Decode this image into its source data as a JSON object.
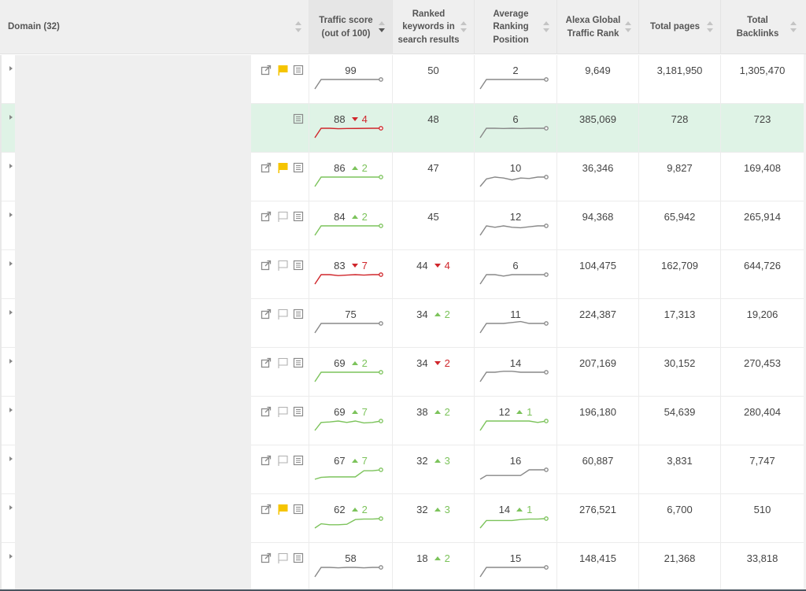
{
  "colors": {
    "up": "#7cc35b",
    "down": "#d0262b",
    "neutral": "#888888",
    "flag_active": "#f5c400",
    "highlight_row": "#dff3e6"
  },
  "header": {
    "columns": [
      {
        "key": "domain",
        "label": "Domain (32)"
      },
      {
        "key": "traffic",
        "label": "Traffic score\n(out of 100)",
        "sorted": "desc"
      },
      {
        "key": "keywords",
        "label": "Ranked\nkeywords in\nsearch results"
      },
      {
        "key": "avgpos",
        "label": "Average\nRanking\nPosition"
      },
      {
        "key": "alexa",
        "label": "Alexa Global\nTraffic Rank"
      },
      {
        "key": "pages",
        "label": "Total pages"
      },
      {
        "key": "backlinks",
        "label": "Total\nBacklinks"
      }
    ]
  },
  "rows": [
    {
      "highlight": false,
      "icons": {
        "external": true,
        "flag": "active",
        "details": true
      },
      "traffic": {
        "value": "99",
        "change": null,
        "dir": "neutral",
        "trend": [
          0,
          1,
          1,
          1,
          1,
          1,
          1,
          1,
          1
        ]
      },
      "keywords": {
        "value": "50",
        "change": null,
        "dir": null
      },
      "avgpos": {
        "value": "2",
        "change": null,
        "dir": "neutral",
        "trend": [
          0,
          1,
          1,
          1,
          1,
          1,
          1,
          1,
          1
        ]
      },
      "alexa": "9,649",
      "pages": "3,181,950",
      "backlinks": "1,305,470"
    },
    {
      "highlight": true,
      "icons": {
        "external": false,
        "flag": "none",
        "details": true
      },
      "traffic": {
        "value": "88",
        "change": "4",
        "dir": "down",
        "trend": [
          0,
          1,
          1,
          0.95,
          0.97,
          0.98,
          0.99,
          1,
          1
        ]
      },
      "keywords": {
        "value": "48",
        "change": null,
        "dir": null
      },
      "avgpos": {
        "value": "6",
        "change": null,
        "dir": "neutral",
        "trend": [
          0,
          1,
          1,
          0.97,
          1,
          0.97,
          1,
          1,
          1
        ]
      },
      "alexa": "385,069",
      "pages": "728",
      "backlinks": "723"
    },
    {
      "highlight": false,
      "icons": {
        "external": true,
        "flag": "active",
        "details": true
      },
      "traffic": {
        "value": "86",
        "change": "2",
        "dir": "up",
        "trend": [
          0,
          1,
          1,
          1,
          1,
          1,
          1,
          1,
          1
        ]
      },
      "keywords": {
        "value": "47",
        "change": null,
        "dir": null
      },
      "avgpos": {
        "value": "10",
        "change": null,
        "dir": "neutral",
        "trend": [
          0,
          0.8,
          1,
          0.9,
          0.7,
          0.9,
          0.85,
          1,
          1
        ]
      },
      "alexa": "36,346",
      "pages": "9,827",
      "backlinks": "169,408"
    },
    {
      "highlight": false,
      "icons": {
        "external": true,
        "flag": "empty",
        "details": true
      },
      "traffic": {
        "value": "84",
        "change": "2",
        "dir": "up",
        "trend": [
          0,
          1,
          1,
          1,
          1,
          1,
          1,
          1,
          1
        ]
      },
      "keywords": {
        "value": "45",
        "change": null,
        "dir": null
      },
      "avgpos": {
        "value": "12",
        "change": null,
        "dir": "neutral",
        "trend": [
          0,
          1,
          0.85,
          1,
          0.85,
          0.8,
          0.9,
          1,
          1
        ]
      },
      "alexa": "94,368",
      "pages": "65,942",
      "backlinks": "265,914"
    },
    {
      "highlight": false,
      "icons": {
        "external": true,
        "flag": "empty",
        "details": true
      },
      "traffic": {
        "value": "83",
        "change": "7",
        "dir": "down",
        "trend": [
          0,
          1,
          1,
          0.9,
          0.95,
          1,
          0.95,
          1,
          1
        ]
      },
      "keywords": {
        "value": "44",
        "change": "4",
        "dir": "down"
      },
      "avgpos": {
        "value": "6",
        "change": null,
        "dir": "neutral",
        "trend": [
          0,
          1,
          1,
          0.85,
          1,
          1,
          1,
          1,
          1
        ]
      },
      "alexa": "104,475",
      "pages": "162,709",
      "backlinks": "644,726"
    },
    {
      "highlight": false,
      "icons": {
        "external": true,
        "flag": "empty",
        "details": true
      },
      "traffic": {
        "value": "75",
        "change": null,
        "dir": "neutral",
        "trend": [
          0,
          1,
          1,
          1,
          1,
          1,
          1,
          1,
          1
        ]
      },
      "keywords": {
        "value": "34",
        "change": "2",
        "dir": "up"
      },
      "avgpos": {
        "value": "11",
        "change": null,
        "dir": "neutral",
        "trend": [
          0,
          1,
          1,
          1,
          1.1,
          1.2,
          1,
          1,
          1
        ]
      },
      "alexa": "224,387",
      "pages": "17,313",
      "backlinks": "19,206"
    },
    {
      "highlight": false,
      "icons": {
        "external": true,
        "flag": "empty",
        "details": true
      },
      "traffic": {
        "value": "69",
        "change": "2",
        "dir": "up",
        "trend": [
          0,
          1,
          1,
          1,
          1,
          1,
          1,
          1,
          1
        ]
      },
      "keywords": {
        "value": "34",
        "change": "2",
        "dir": "down"
      },
      "avgpos": {
        "value": "14",
        "change": null,
        "dir": "neutral",
        "trend": [
          0,
          1,
          1,
          1.1,
          1.1,
          1,
          1,
          1,
          1
        ]
      },
      "alexa": "207,169",
      "pages": "30,152",
      "backlinks": "270,453"
    },
    {
      "highlight": false,
      "icons": {
        "external": true,
        "flag": "empty",
        "details": true
      },
      "traffic": {
        "value": "69",
        "change": "7",
        "dir": "up",
        "trend": [
          0,
          0.85,
          0.9,
          1,
          0.85,
          1,
          0.8,
          0.85,
          1
        ]
      },
      "keywords": {
        "value": "38",
        "change": "2",
        "dir": "up"
      },
      "avgpos": {
        "value": "12",
        "change": "1",
        "dir": "up",
        "trend": [
          0,
          1,
          1,
          1,
          1,
          1,
          1,
          0.85,
          1
        ]
      },
      "alexa": "196,180",
      "pages": "54,639",
      "backlinks": "280,404"
    },
    {
      "highlight": false,
      "icons": {
        "external": true,
        "flag": "empty",
        "details": true
      },
      "traffic": {
        "value": "67",
        "change": "7",
        "dir": "up",
        "trend": [
          0,
          0.2,
          0.25,
          0.25,
          0.25,
          0.25,
          0.9,
          0.9,
          1
        ]
      },
      "keywords": {
        "value": "32",
        "change": "3",
        "dir": "up"
      },
      "avgpos": {
        "value": "16",
        "change": null,
        "dir": "neutral",
        "trend": [
          0,
          0.4,
          0.4,
          0.4,
          0.4,
          0.4,
          1,
          1,
          1
        ]
      },
      "alexa": "60,887",
      "pages": "3,831",
      "backlinks": "7,747"
    },
    {
      "highlight": false,
      "icons": {
        "external": true,
        "flag": "active",
        "details": true
      },
      "traffic": {
        "value": "62",
        "change": "2",
        "dir": "up",
        "trend": [
          0,
          0.45,
          0.35,
          0.35,
          0.4,
          0.9,
          0.95,
          0.95,
          1
        ]
      },
      "keywords": {
        "value": "32",
        "change": "3",
        "dir": "up"
      },
      "avgpos": {
        "value": "14",
        "change": "1",
        "dir": "up",
        "trend": [
          0,
          0.8,
          0.8,
          0.8,
          0.8,
          0.9,
          0.95,
          0.95,
          1
        ]
      },
      "alexa": "276,521",
      "pages": "6,700",
      "backlinks": "510"
    },
    {
      "highlight": false,
      "icons": {
        "external": true,
        "flag": "empty",
        "details": true
      },
      "traffic": {
        "value": "58",
        "change": null,
        "dir": "neutral",
        "trend": [
          0,
          1,
          1,
          0.95,
          1,
          1,
          0.95,
          1,
          1
        ]
      },
      "keywords": {
        "value": "18",
        "change": "2",
        "dir": "up"
      },
      "avgpos": {
        "value": "15",
        "change": null,
        "dir": "neutral",
        "trend": [
          0,
          1,
          1,
          1,
          1,
          1,
          1,
          1,
          1
        ]
      },
      "alexa": "148,415",
      "pages": "21,368",
      "backlinks": "33,818"
    }
  ]
}
